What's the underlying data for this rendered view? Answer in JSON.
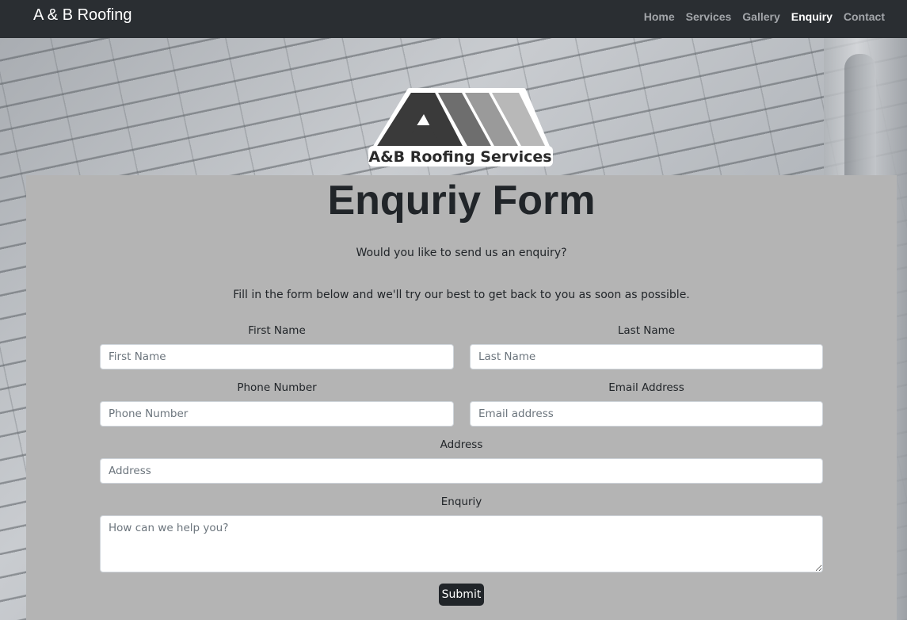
{
  "navbar": {
    "brand": "A & B Roofing",
    "links": [
      {
        "label": "Home",
        "active": false
      },
      {
        "label": "Services",
        "active": false
      },
      {
        "label": "Gallery",
        "active": false
      },
      {
        "label": "Enquiry",
        "active": true
      },
      {
        "label": "Contact",
        "active": false
      }
    ]
  },
  "logo": {
    "text": "A&B Roofing Services",
    "icon": "roof-stripes-logo"
  },
  "form": {
    "title": "Enquriy Form",
    "intro_line1": "Would you like to send us an enquiry?",
    "intro_line2": "Fill in the form below and we'll try our best to get back to you as soon as possible.",
    "first_name": {
      "label": "First Name",
      "placeholder": "First Name",
      "value": ""
    },
    "last_name": {
      "label": "Last Name",
      "placeholder": "Last Name",
      "value": ""
    },
    "phone": {
      "label": "Phone Number",
      "placeholder": "Phone Number",
      "value": ""
    },
    "email": {
      "label": "Email Address",
      "placeholder": "Email address",
      "value": ""
    },
    "address": {
      "label": "Address",
      "placeholder": "Address",
      "value": ""
    },
    "enquiry": {
      "label": "Enquriy",
      "placeholder": "How can we help you?",
      "value": ""
    },
    "submit_label": "Submit"
  },
  "colors": {
    "navbar_bg": "#2a2e32",
    "panel_bg": "#b4b4b4",
    "button_bg": "#212529"
  }
}
